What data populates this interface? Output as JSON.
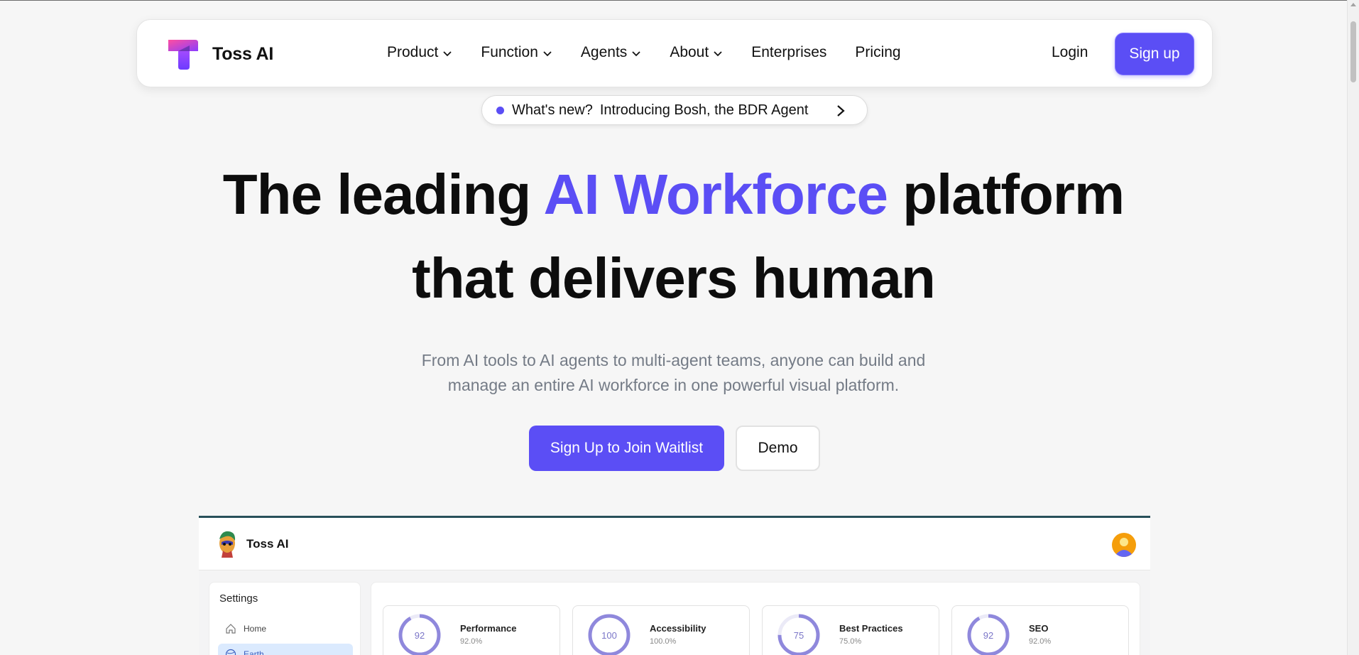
{
  "nav": {
    "brand": "Toss AI",
    "items": [
      {
        "label": "Product",
        "has_dropdown": true
      },
      {
        "label": "Function",
        "has_dropdown": true
      },
      {
        "label": "Agents",
        "has_dropdown": true
      },
      {
        "label": "About",
        "has_dropdown": true
      },
      {
        "label": "Enterprises",
        "has_dropdown": false
      },
      {
        "label": "Pricing",
        "has_dropdown": false
      }
    ],
    "login_label": "Login",
    "signup_label": "Sign up"
  },
  "announcement": {
    "prefix": "What's new?",
    "text": "Introducing Bosh, the BDR Agent"
  },
  "hero": {
    "line1_before": "The leading ",
    "line1_accent": "AI Workforce",
    "line1_after": " platform",
    "line2": "that delivers human",
    "subtitle_line1": "From AI tools to AI agents to multi-agent teams, anyone can build and",
    "subtitle_line2": "manage an entire AI workforce in one powerful visual platform.",
    "cta_primary": "Sign Up to Join Waitlist",
    "cta_secondary": "Demo"
  },
  "preview": {
    "brand": "Toss AI",
    "settings": {
      "title": "Settings",
      "items": [
        {
          "label": "Home",
          "icon": "home-icon",
          "active": false
        },
        {
          "label": "Earth",
          "icon": "globe-icon",
          "active": true
        }
      ]
    },
    "metrics": [
      {
        "label": "Performance",
        "score": "92",
        "percent_text": "92.0%",
        "fraction": 0.92
      },
      {
        "label": "Accessibility",
        "score": "100",
        "percent_text": "100.0%",
        "fraction": 1.0
      },
      {
        "label": "Best Practices",
        "score": "75",
        "percent_text": "75.0%",
        "fraction": 0.75
      },
      {
        "label": "SEO",
        "score": "92",
        "percent_text": "92.0%",
        "fraction": 0.92
      }
    ]
  },
  "colors": {
    "accent": "#5b4ef5",
    "ring": "#8f88dc",
    "subtitle": "#747b86"
  }
}
